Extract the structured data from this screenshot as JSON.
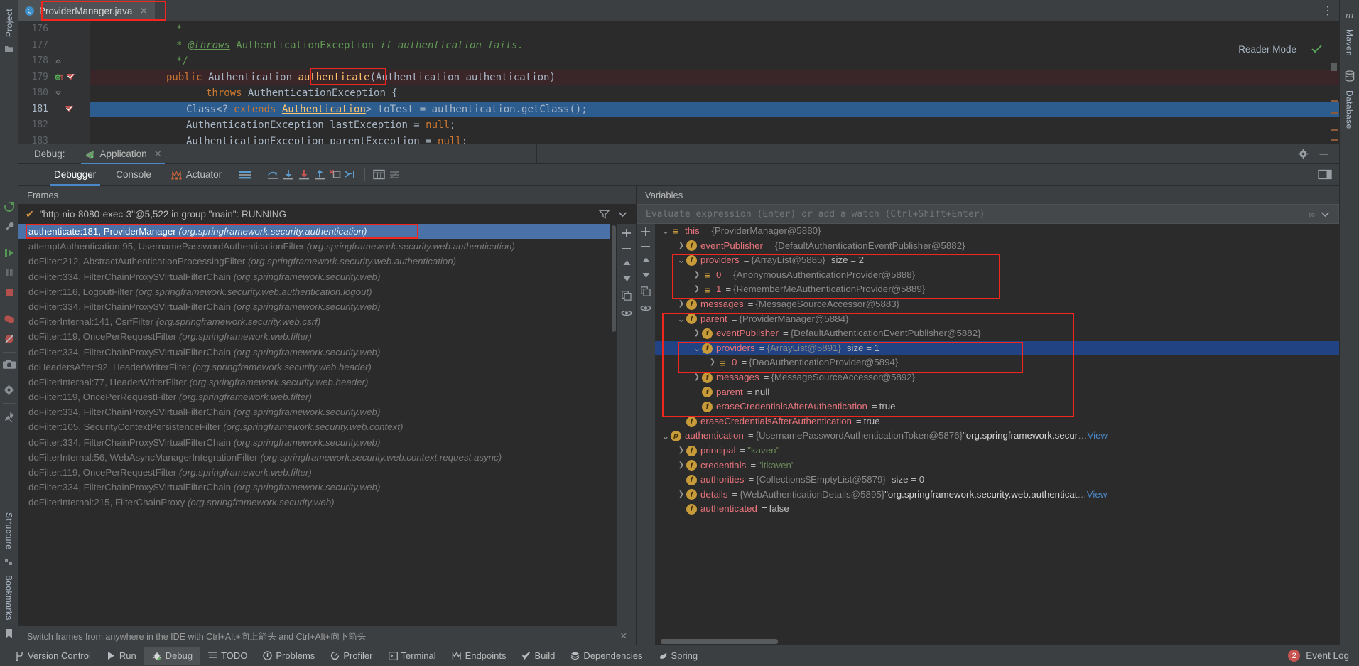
{
  "editor": {
    "tab": {
      "label": "ProviderManager.java",
      "icon": "java-class-icon",
      "close": "✕"
    },
    "reader_mode": "Reader Mode",
    "more_icon": "⋮",
    "lines": [
      {
        "num": "176",
        "marks": [],
        "state": "normal"
      },
      {
        "num": "177",
        "marks": [],
        "state": "normal"
      },
      {
        "num": "178",
        "marks": [
          "fold-up"
        ],
        "state": "normal"
      },
      {
        "num": "179",
        "marks": [
          "override",
          "breakpoint"
        ],
        "state": "breakpoint"
      },
      {
        "num": "180",
        "marks": [
          "fold-down"
        ],
        "state": "normal"
      },
      {
        "num": "181",
        "marks": [
          "breakpoint"
        ],
        "state": "current"
      },
      {
        "num": "182",
        "marks": [],
        "state": "normal"
      },
      {
        "num": "183",
        "marks": [],
        "state": "normal"
      }
    ],
    "highlighted_token": "authenticate"
  },
  "debug_window": {
    "title": "Debug:",
    "tab": {
      "label": "Application",
      "icon": "spring-boot-icon",
      "close": "✕"
    },
    "settings_icon": "gear-icon",
    "minimize_icon": "minimize-icon",
    "tabs": [
      {
        "label": "Debugger",
        "active": true
      },
      {
        "label": "Console",
        "active": false
      },
      {
        "label": "Actuator",
        "active": false,
        "icon": "actuator-icon"
      }
    ],
    "toolbar_icons": [
      "layout-icon",
      "step-over-icon",
      "step-into-icon",
      "force-step-into-icon",
      "step-out-icon",
      "drop-frame-icon",
      "run-to-cursor-icon",
      "evaluate-icon",
      "mute-icon"
    ],
    "restore_layout_icon": "restore-layout-icon"
  },
  "sidebar_left": {
    "top_labels": [
      "Project"
    ],
    "bottom_labels": [
      "Structure",
      "Bookmarks"
    ],
    "debug_actions": [
      "rerun-icon",
      "settings-wrench-icon",
      "resume-icon",
      "pause-icon",
      "stop-icon",
      "view-breakpoints-icon",
      "mute-breakpoints-icon",
      "camera-icon",
      "settings-gear-icon",
      "pin-icon"
    ]
  },
  "sidebar_right": {
    "labels": [
      "Maven",
      "Database"
    ],
    "icons": [
      "maven-icon",
      "database-icon"
    ]
  },
  "frames": {
    "title": "Frames",
    "thread": "\"http-nio-8080-exec-3\"@5,522 in group \"main\": RUNNING",
    "thread_check": "✔",
    "filter_icon": "filter-icon",
    "dropdown_icon": "chevron-down-icon",
    "controls": [
      "add-icon",
      "remove-icon",
      "up-icon",
      "down-icon",
      "copy-icon",
      "eye-icon"
    ],
    "items": [
      {
        "method": "authenticate:181, ProviderManager",
        "pkg": "(org.springframework.security.authentication)",
        "selected": true
      },
      {
        "method": "attemptAuthentication:95, UsernamePasswordAuthenticationFilter",
        "pkg": "(org.springframework.security.web.authentication)",
        "selected": false
      },
      {
        "method": "doFilter:212, AbstractAuthenticationProcessingFilter",
        "pkg": "(org.springframework.security.web.authentication)",
        "selected": false
      },
      {
        "method": "doFilter:334, FilterChainProxy$VirtualFilterChain",
        "pkg": "(org.springframework.security.web)",
        "selected": false
      },
      {
        "method": "doFilter:116, LogoutFilter",
        "pkg": "(org.springframework.security.web.authentication.logout)",
        "selected": false
      },
      {
        "method": "doFilter:334, FilterChainProxy$VirtualFilterChain",
        "pkg": "(org.springframework.security.web)",
        "selected": false
      },
      {
        "method": "doFilterInternal:141, CsrfFilter",
        "pkg": "(org.springframework.security.web.csrf)",
        "selected": false
      },
      {
        "method": "doFilter:119, OncePerRequestFilter",
        "pkg": "(org.springframework.web.filter)",
        "selected": false
      },
      {
        "method": "doFilter:334, FilterChainProxy$VirtualFilterChain",
        "pkg": "(org.springframework.security.web)",
        "selected": false
      },
      {
        "method": "doHeadersAfter:92, HeaderWriterFilter",
        "pkg": "(org.springframework.security.web.header)",
        "selected": false
      },
      {
        "method": "doFilterInternal:77, HeaderWriterFilter",
        "pkg": "(org.springframework.security.web.header)",
        "selected": false
      },
      {
        "method": "doFilter:119, OncePerRequestFilter",
        "pkg": "(org.springframework.web.filter)",
        "selected": false
      },
      {
        "method": "doFilter:334, FilterChainProxy$VirtualFilterChain",
        "pkg": "(org.springframework.security.web)",
        "selected": false
      },
      {
        "method": "doFilter:105, SecurityContextPersistenceFilter",
        "pkg": "(org.springframework.security.web.context)",
        "selected": false
      },
      {
        "method": "doFilter:334, FilterChainProxy$VirtualFilterChain",
        "pkg": "(org.springframework.security.web)",
        "selected": false
      },
      {
        "method": "doFilterInternal:56, WebAsyncManagerIntegrationFilter",
        "pkg": "(org.springframework.security.web.context.request.async)",
        "selected": false
      },
      {
        "method": "doFilter:119, OncePerRequestFilter",
        "pkg": "(org.springframework.web.filter)",
        "selected": false
      },
      {
        "method": "doFilter:334, FilterChainProxy$VirtualFilterChain",
        "pkg": "(org.springframework.security.web)",
        "selected": false
      },
      {
        "method": "doFilterInternal:215, FilterChainProxy",
        "pkg": "(org.springframework.security.web)",
        "selected": false
      }
    ],
    "hint": "Switch frames from anywhere in the IDE with Ctrl+Alt+向上箭头 and Ctrl+Alt+向下箭头",
    "hint_close": "✕"
  },
  "variables": {
    "title": "Variables",
    "eval_placeholder": "Evaluate expression (Enter) or add a watch (Ctrl+Shift+Enter)",
    "eval_value": "",
    "eval_icons": [
      "history-icon",
      "chevron-down-icon"
    ],
    "side_icons": [
      "add-icon",
      "remove-icon",
      "up-icon",
      "down-icon",
      "copy-icon",
      "eye-icon"
    ],
    "rows": [
      {
        "indent": 0,
        "arrow": "v",
        "badge": "arr",
        "badge_text": "≡",
        "name": "this",
        "eq": "=",
        "value": "{ProviderManager@5880}",
        "selected": false
      },
      {
        "indent": 1,
        "arrow": ">",
        "badge": "f",
        "badge_text": "f",
        "name": "eventPublisher",
        "eq": "=",
        "value": "{DefaultAuthenticationEventPublisher@5882}",
        "selected": false
      },
      {
        "indent": 1,
        "arrow": "v",
        "badge": "f",
        "badge_text": "f",
        "name": "providers",
        "eq": "=",
        "value": "{ArrayList@5885}",
        "size": "size = 2",
        "selected": false
      },
      {
        "indent": 2,
        "arrow": ">",
        "badge": "arr",
        "badge_text": "≡",
        "name": "0",
        "eq": "=",
        "value": "{AnonymousAuthenticationProvider@5888}",
        "selected": false
      },
      {
        "indent": 2,
        "arrow": ">",
        "badge": "arr",
        "badge_text": "≡",
        "name": "1",
        "eq": "=",
        "value": "{RememberMeAuthenticationProvider@5889}",
        "selected": false
      },
      {
        "indent": 1,
        "arrow": ">",
        "badge": "f",
        "badge_text": "f",
        "name": "messages",
        "eq": "=",
        "value": "{MessageSourceAccessor@5883}",
        "selected": false
      },
      {
        "indent": 1,
        "arrow": "v",
        "badge": "f",
        "badge_text": "f",
        "name": "parent",
        "eq": "=",
        "value": "{ProviderManager@5884}",
        "selected": false
      },
      {
        "indent": 2,
        "arrow": ">",
        "badge": "f",
        "badge_text": "f",
        "name": "eventPublisher",
        "eq": "=",
        "value": "{DefaultAuthenticationEventPublisher@5882}",
        "selected": false
      },
      {
        "indent": 2,
        "arrow": "v",
        "badge": "f",
        "badge_text": "f",
        "name": "providers",
        "eq": "=",
        "value": "{ArrayList@5891}",
        "size": "size = 1",
        "selected": true
      },
      {
        "indent": 3,
        "arrow": ">",
        "badge": "arr",
        "badge_text": "≡",
        "name": "0",
        "eq": "=",
        "value": "{DaoAuthenticationProvider@5894}",
        "selected": false
      },
      {
        "indent": 2,
        "arrow": ">",
        "badge": "f",
        "badge_text": "f",
        "name": "messages",
        "eq": "=",
        "value": "{MessageSourceAccessor@5892}",
        "selected": false
      },
      {
        "indent": 2,
        "arrow": "",
        "badge": "f",
        "badge_text": "f",
        "name": "parent",
        "eq": "=",
        "value": "null",
        "value_kind": "plain",
        "selected": false
      },
      {
        "indent": 2,
        "arrow": "",
        "badge": "f",
        "badge_text": "f",
        "name": "eraseCredentialsAfterAuthentication",
        "eq": "=",
        "value": "true",
        "value_kind": "plain",
        "selected": false
      },
      {
        "indent": 1,
        "arrow": "",
        "badge": "f",
        "badge_text": "f",
        "name": "eraseCredentialsAfterAuthentication",
        "eq": "=",
        "value": "true",
        "value_kind": "plain",
        "selected": false
      },
      {
        "indent": 0,
        "arrow": "v",
        "badge": "p",
        "badge_text": "p",
        "name": "authentication",
        "eq": "=",
        "value": "{UsernamePasswordAuthenticationToken@5876}",
        "extra": "\"org.springframework.secur",
        "ellipsis": "…",
        "link": "View",
        "selected": false
      },
      {
        "indent": 1,
        "arrow": ">",
        "badge": "f",
        "badge_text": "f",
        "name": "principal",
        "eq": "=",
        "value": "\"kaven\"",
        "value_kind": "string",
        "selected": false
      },
      {
        "indent": 1,
        "arrow": ">",
        "badge": "f",
        "badge_text": "f",
        "name": "credentials",
        "eq": "=",
        "value": "\"itkaven\"",
        "value_kind": "string",
        "selected": false
      },
      {
        "indent": 1,
        "arrow": "",
        "badge": "f",
        "badge_text": "f",
        "name": "authorities",
        "eq": "=",
        "value": "{Collections$EmptyList@5879}",
        "size": "size = 0",
        "selected": false
      },
      {
        "indent": 1,
        "arrow": ">",
        "badge": "f",
        "badge_text": "f",
        "name": "details",
        "eq": "=",
        "value": "{WebAuthenticationDetails@5895}",
        "extra": "\"org.springframework.security.web.authenticat",
        "ellipsis": "…",
        "link": "View",
        "selected": false
      },
      {
        "indent": 1,
        "arrow": "",
        "badge": "f",
        "badge_text": "f",
        "name": "authenticated",
        "eq": "=",
        "value": "false",
        "value_kind": "plain",
        "selected": false
      }
    ]
  },
  "statusbar": {
    "items": [
      {
        "label": "Version Control",
        "icon": "branch-icon",
        "active": false
      },
      {
        "label": "Run",
        "icon": "run-icon",
        "active": false
      },
      {
        "label": "Debug",
        "icon": "debug-icon",
        "active": true
      },
      {
        "label": "TODO",
        "icon": "todo-icon",
        "active": false
      },
      {
        "label": "Problems",
        "icon": "problems-icon",
        "active": false
      },
      {
        "label": "Profiler",
        "icon": "profiler-icon",
        "active": false
      },
      {
        "label": "Terminal",
        "icon": "terminal-icon",
        "active": false
      },
      {
        "label": "Endpoints",
        "icon": "endpoints-icon",
        "active": false
      },
      {
        "label": "Build",
        "icon": "build-icon",
        "active": false
      },
      {
        "label": "Dependencies",
        "icon": "dependencies-icon",
        "active": false
      },
      {
        "label": "Spring",
        "icon": "spring-icon",
        "active": false
      }
    ],
    "event_log": {
      "label": "Event Log",
      "count": "2"
    }
  },
  "colors": {
    "accent": "#4a88c7",
    "highlight_box": "#f2261f",
    "selection": "#4a72a8",
    "tree_selection": "#214283",
    "breakpoint_line": "#3a2628",
    "panel_bg": "#3c3f41",
    "editor_bg": "#2b2b2b"
  }
}
